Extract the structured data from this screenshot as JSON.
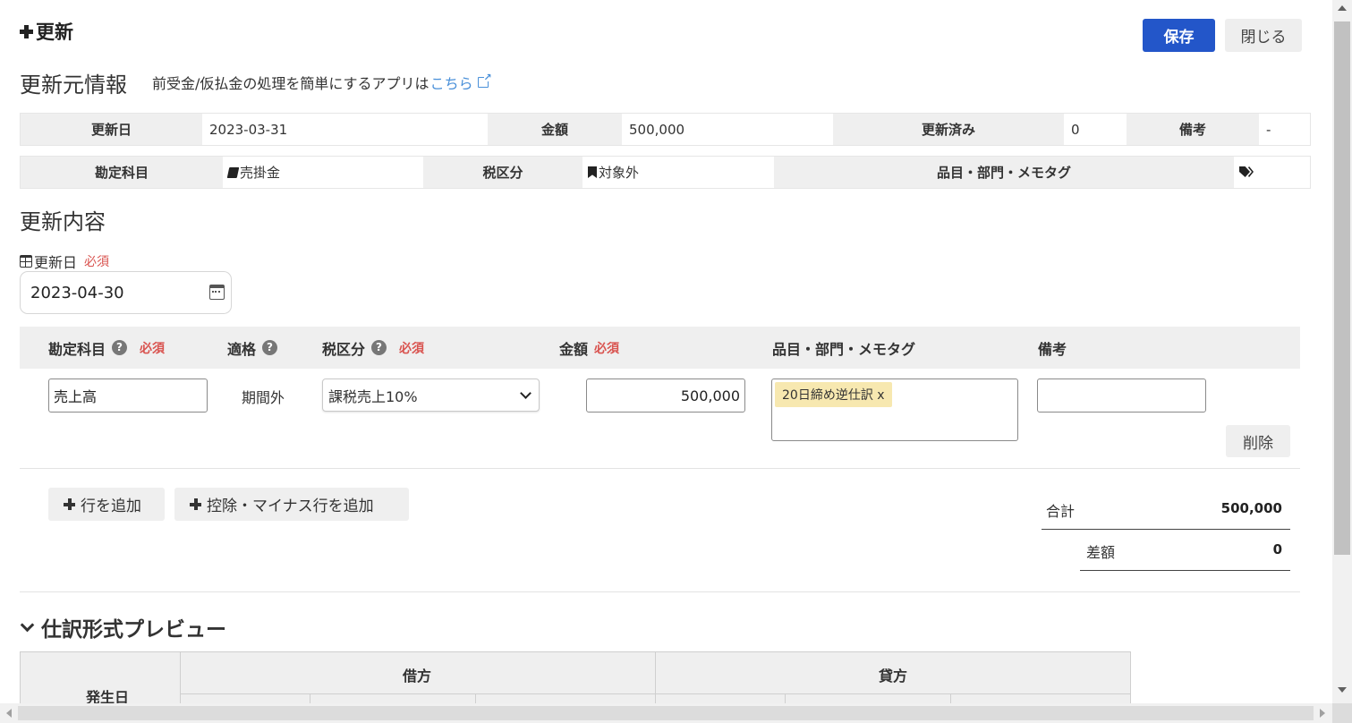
{
  "header": {
    "title": "更新",
    "save_label": "保存",
    "close_label": "閉じる"
  },
  "source_info": {
    "section_title": "更新元情報",
    "note_prefix": "前受金/仮払金の処理を簡単にするアプリは",
    "note_link": "こちら",
    "row1": {
      "update_date_label": "更新日",
      "update_date_value": "2023-03-31",
      "amount_label": "金額",
      "amount_value": "500,000",
      "updated_label": "更新済み",
      "updated_value": "0",
      "memo_label": "備考",
      "memo_value": "-"
    },
    "row2": {
      "account_label": "勘定科目",
      "account_value": "売掛金",
      "tax_label": "税区分",
      "tax_value": "対象外",
      "tags_label": "品目・部門・メモタグ"
    }
  },
  "update_content": {
    "section_title": "更新内容",
    "date_label": "更新日",
    "required": "必須",
    "date_value": "2023-04-30"
  },
  "entry_table": {
    "headers": {
      "account": "勘定科目",
      "eligibility": "適格",
      "tax": "税区分",
      "amount": "金額",
      "tags": "品目・部門・メモタグ",
      "memo": "備考"
    },
    "required": "必須",
    "row": {
      "account": "売上高",
      "eligibility": "期間外",
      "tax": "課税売上10%",
      "amount": "500,000",
      "tag": "20日締め逆仕訳 x",
      "memo": "",
      "delete_label": "削除"
    }
  },
  "actions": {
    "add_row": "行を追加",
    "add_deduction_row": "控除・マイナス行を追加"
  },
  "totals": {
    "total_label": "合計",
    "total_value": "500,000",
    "diff_label": "差額",
    "diff_value": "0"
  },
  "preview": {
    "title": "仕訳形式プレビュー",
    "col_date": "発生日",
    "col_debit": "借方",
    "col_credit": "貸方"
  }
}
